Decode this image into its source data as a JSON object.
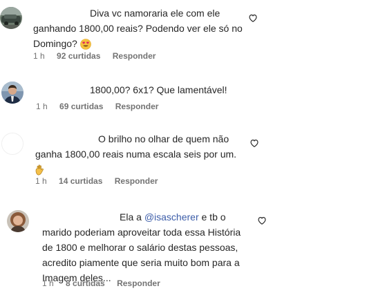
{
  "comments": [
    {
      "lines": [
        "Diva vc namoraria ele com ele",
        "ganhando 1800,00 reais? Podendo ver ele só no",
        "Domingo?"
      ],
      "emoji": "heart-eyes",
      "time": "1 h",
      "likes": "92 curtidas",
      "reply": "Responder"
    },
    {
      "lines": [
        "1800,00? 6x1? Que lamentável!"
      ],
      "time": "1 h",
      "likes": "69 curtidas",
      "reply": "Responder"
    },
    {
      "lines": [
        "O brilho no olhar de quem não",
        "ganha 1800,00 reais numa escala seis por um."
      ],
      "emoji": "ok-hand",
      "time": "1 h",
      "likes": "14 curtidas",
      "reply": "Responder"
    },
    {
      "line1_before": "Ela a ",
      "mention": "@isascherer",
      "line1_after": " e tb o",
      "lines": [
        "marido poderiam aproveitar toda essa História",
        "de 1800 e melhorar o salário destas pessoas,",
        "acredito piamente que seria muito bom para a",
        "Imagem deles..."
      ],
      "time": "1 h",
      "likes": "8 curtidas",
      "reply": "Responder"
    }
  ],
  "colors": {
    "text": "#262626",
    "meta": "#737373",
    "mention": "#3b5ca8"
  }
}
